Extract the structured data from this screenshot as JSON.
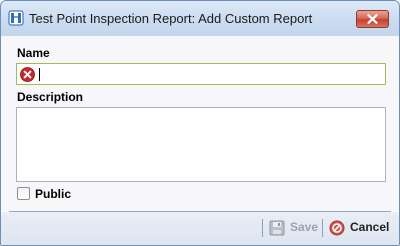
{
  "window": {
    "title": "Test Point Inspection Report:  Add Custom Report",
    "icons": {
      "app": "mcm-app-icon",
      "close": "close-icon"
    }
  },
  "form": {
    "name_label": "Name",
    "name_value": "",
    "name_status": "error",
    "description_label": "Description",
    "description_value": "",
    "public_label": "Public",
    "public_checked": false
  },
  "footer": {
    "save_label": "Save",
    "save_enabled": false,
    "cancel_label": "Cancel"
  },
  "colors": {
    "titlebar": "#cbdcf0",
    "close_button": "#c2412f",
    "name_border_valid": "#9fbf55",
    "error_icon": "#c8282d",
    "disabled_text": "#9aa3ad"
  }
}
